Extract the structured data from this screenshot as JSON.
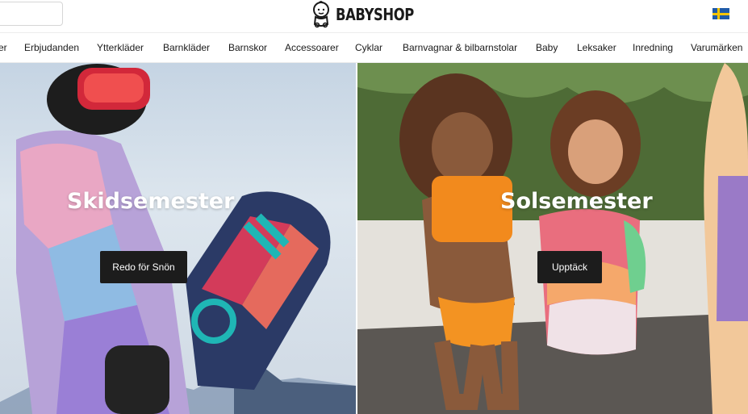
{
  "header": {
    "logo_text": "BABYSHOP",
    "search": {
      "placeholder": ""
    },
    "locale_flag": "sweden-flag-icon"
  },
  "nav": {
    "items": [
      {
        "label": "er"
      },
      {
        "label": "Erbjudanden"
      },
      {
        "label": "Ytterkläder"
      },
      {
        "label": "Barnkläder"
      },
      {
        "label": "Barnskor"
      },
      {
        "label": "Accessoarer"
      },
      {
        "label": "Cyklar"
      },
      {
        "label": "Barnvagnar & bilbarnstolar"
      },
      {
        "label": "Baby"
      },
      {
        "label": "Leksaker"
      },
      {
        "label": "Inredning"
      },
      {
        "label": "Varumärken"
      }
    ]
  },
  "heroes": [
    {
      "title": "Skidsemester",
      "button_label": "Redo för Snön"
    },
    {
      "title": "Solsemester",
      "button_label": "Upptäck"
    }
  ],
  "colors": {
    "button_bg": "#1c1c1c",
    "text": "#1a1a1a",
    "flag_blue": "#1f5ba8",
    "flag_yellow": "#f5c400"
  }
}
